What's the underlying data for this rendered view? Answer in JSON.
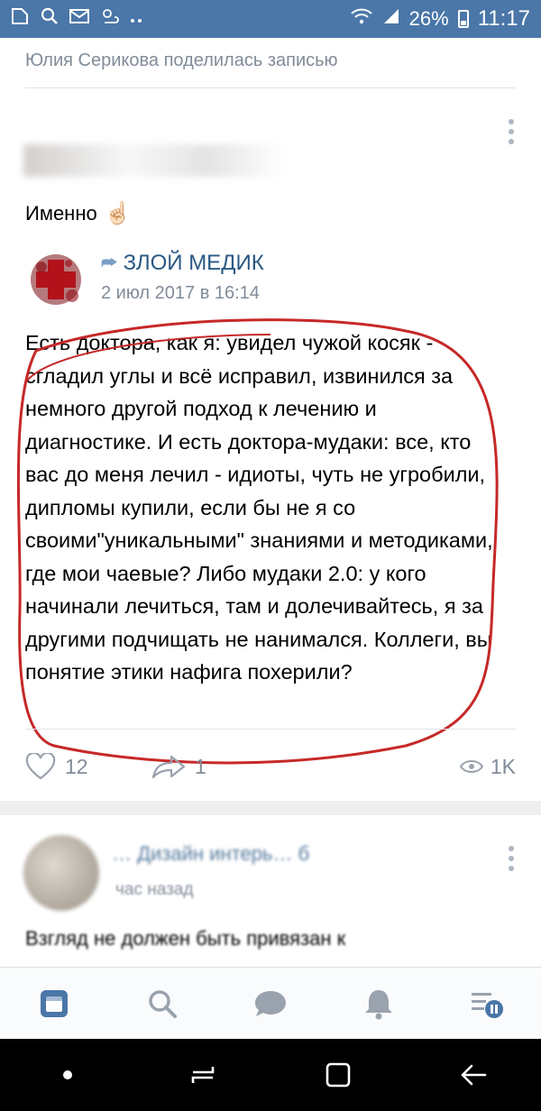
{
  "status_bar": {
    "battery_percent": "26%",
    "time": "11:17"
  },
  "card1": {
    "shared_by": "Юлия Серикова поделилась записью",
    "post_text": "Именно",
    "post_emoji": "☝🏻",
    "repost": {
      "author": "ЗЛОЙ МЕДИК",
      "date": "2 июл 2017 в 16:14",
      "body": "Есть доктора, как я: увидел чужой косяк - сгладил углы и всё исправил, извинился за немного другой подход к лечению и диагностике. И есть доктора-мудаки: все, кто вас до меня лечил - идиоты, чуть не угробили, дипломы купили, если бы не я со своими\"уникальными\" знаниями и методиками, где мои чаевые? Либо мудаки 2.0: у кого начинали лечиться, там и долечивайтесь, я за другими подчищать не нанимался. Коллеги, вы понятие этики нафига похерили?"
    },
    "actions": {
      "likes": "12",
      "shares": "1",
      "views": "1K"
    }
  },
  "card2": {
    "author_partial": "… Дизайн интерь… б",
    "time": "час назад",
    "text": "Взгляд не должен быть привязан к"
  },
  "colors": {
    "accent": "#4a76a8",
    "link": "#2a5885",
    "muted": "#818c99",
    "scribble": "#c62828"
  },
  "icons": {
    "nav": [
      "news-icon",
      "search-icon",
      "messages-icon",
      "notifications-icon",
      "menu-icon"
    ]
  }
}
